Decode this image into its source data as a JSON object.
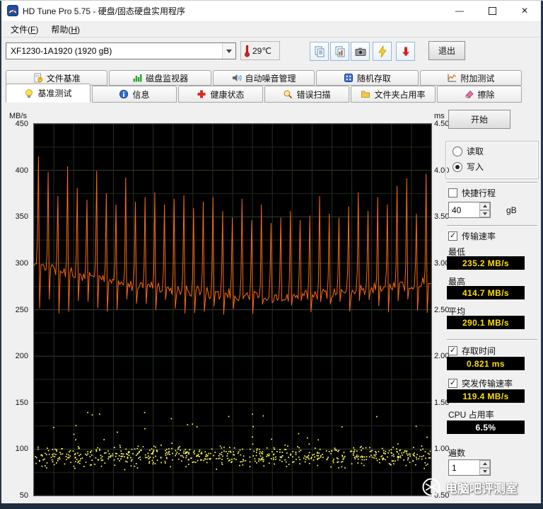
{
  "window": {
    "title": "HD Tune Pro 5.75 - 硬盘/固态硬盘实用程序",
    "controls": {
      "minimize": "—",
      "close": "✕"
    }
  },
  "menu": {
    "file_pre": "文件(",
    "file_key": "F",
    "file_post": ")",
    "help_pre": "帮助(",
    "help_key": "H",
    "help_post": ")"
  },
  "toolbar": {
    "drive": "XF1230-1A1920 (1920 gB)",
    "temperature": "29℃",
    "exit": "退出"
  },
  "tabs": {
    "row1": [
      "文件基准",
      "磁盘监视器",
      "自动噪音管理",
      "随机存取",
      "附加测试"
    ],
    "row2": [
      "基准测试",
      "信息",
      "健康状态",
      "错误扫描",
      "文件夹占用率",
      "擦除"
    ],
    "active": "基准测试"
  },
  "panel": {
    "start": "开始",
    "read": "读取",
    "write": "写入",
    "short_stroke": "快捷行程",
    "short_stroke_value": "40",
    "short_stroke_unit": "gB",
    "transfer_rate": "传输速率",
    "min_label": "最低",
    "min_value": "235.2 MB/s",
    "max_label": "最高",
    "max_value": "414.7 MB/s",
    "avg_label": "平均",
    "avg_value": "290.1 MB/s",
    "access_time": "存取时间",
    "access_time_value": "0.821 ms",
    "burst_rate": "突发传输速率",
    "burst_rate_value": "119.4 MB/s",
    "cpu_label": "CPU 占用率",
    "cpu_value": "6.5%",
    "passes_label": "遍数",
    "passes_value": "1"
  },
  "watermark": {
    "text": "电脑吧评测室"
  },
  "chart_data": {
    "type": "line",
    "title": "",
    "left_axis": {
      "label": "MB/s",
      "min": 50,
      "max": 450,
      "ticks": [
        "450",
        "400",
        "350",
        "300",
        "250",
        "200",
        "150",
        "100",
        "50"
      ]
    },
    "right_axis": {
      "label": "ms",
      "min": 0.5,
      "max": 4.5,
      "ticks": [
        "4.50",
        "4.00",
        "3.50",
        "3.00",
        "2.50",
        "2.00",
        "1.50",
        "1.00",
        "0.50"
      ]
    },
    "grid": {
      "v_divisions": 20,
      "h_minor_step": 25,
      "h_major_step": 50
    },
    "series": [
      {
        "name": "写入传输速率",
        "unit": "MB/s",
        "axis": "left",
        "color": "#ff6a12",
        "min": 235.2,
        "max": 414.7,
        "avg": 290.1,
        "baseline": [
          302,
          296,
          292,
          290,
          288,
          286,
          284,
          282,
          280,
          278,
          277,
          276,
          275,
          274,
          272,
          271,
          270,
          269,
          268,
          267,
          266,
          265,
          264,
          264,
          263,
          263,
          264,
          265,
          266,
          267,
          268,
          269,
          270,
          271,
          272,
          273,
          274,
          275,
          276,
          277,
          278
        ],
        "spike_peaks": [
          414.7,
          398,
          372,
          404,
          381,
          368,
          399,
          375,
          363,
          392,
          366,
          371,
          376,
          363,
          369,
          373,
          359,
          366,
          371,
          356,
          349,
          369,
          346,
          363,
          343,
          349,
          356,
          346,
          351,
          372,
          353,
          349,
          361,
          376,
          356,
          371,
          363,
          383,
          391,
          353,
          396
        ],
        "dip_floor": 244
      },
      {
        "name": "存取时间",
        "unit": "ms",
        "axis": "right",
        "type": "scatter",
        "color": "#ffff55",
        "avg": 0.821,
        "scatter_range": [
          0.76,
          1.1
        ],
        "outlier_range": [
          1.1,
          1.42
        ],
        "points": 650,
        "outliers": 28
      }
    ]
  }
}
